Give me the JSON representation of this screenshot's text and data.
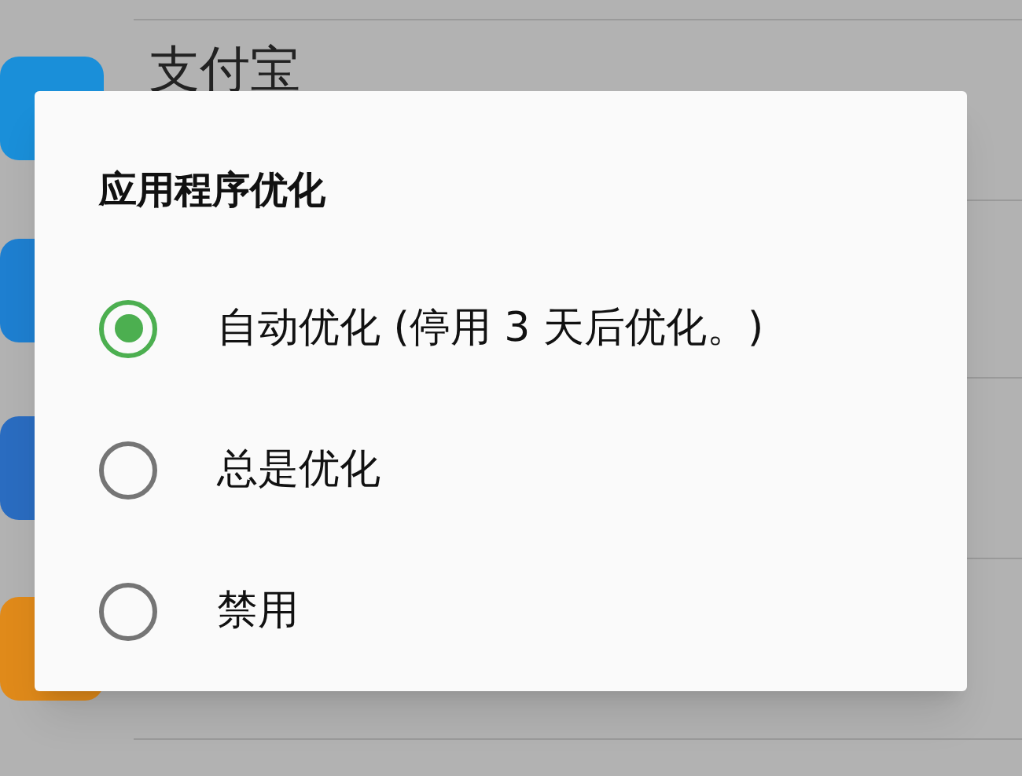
{
  "background_list": {
    "app_name": "支付宝"
  },
  "dialog": {
    "title": "应用程序优化",
    "options": [
      {
        "label": "自动优化 (停用 3 天后优化。)",
        "selected": true
      },
      {
        "label": "总是优化",
        "selected": false
      },
      {
        "label": "禁用",
        "selected": false
      }
    ]
  }
}
